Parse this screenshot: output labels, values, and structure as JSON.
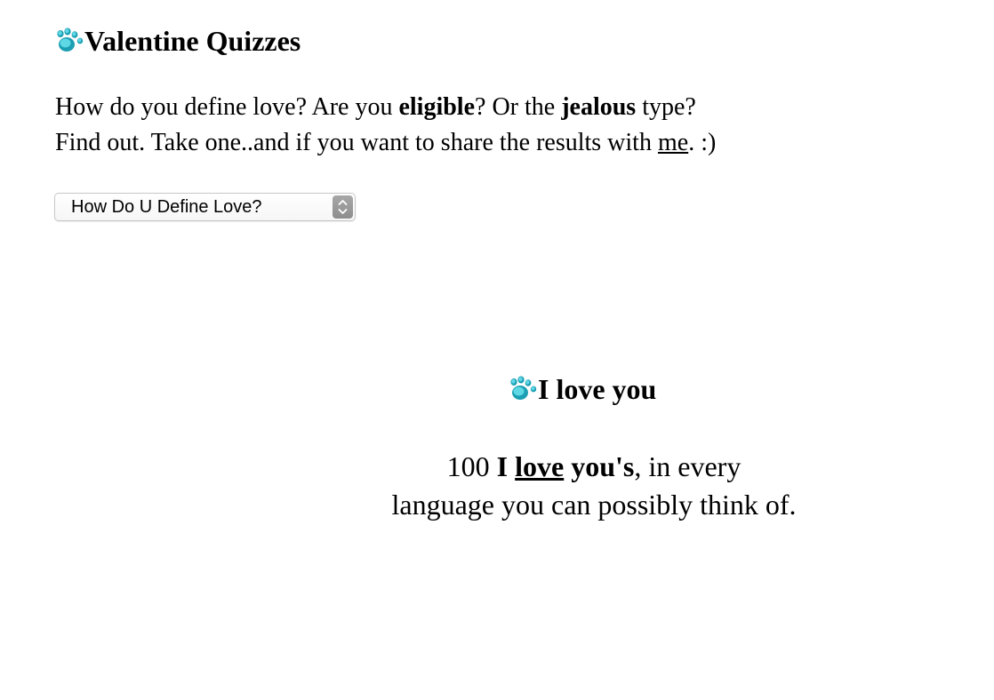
{
  "quiz_section": {
    "icon": "paw-print-icon",
    "title": "Valentine Quizzes",
    "intro": {
      "line1_part1": "How do you define love? Are you ",
      "line1_bold1": "eligible",
      "line1_part2": "? Or the ",
      "line1_bold2": "jealous",
      "line1_part3": " type?",
      "line2_part1": "Find out. Take one..and if you want to share the results with ",
      "line2_link": "me",
      "line2_part2": ". :)"
    },
    "quiz_select": {
      "selected": "How Do U Define Love?"
    }
  },
  "love_section": {
    "icon": "paw-print-icon",
    "title": "I love you",
    "text": {
      "part1": "100 ",
      "bold1": "I",
      "space1": " ",
      "link": "love",
      "space2": " ",
      "bold2": "you's",
      "part2": ", in every",
      "line2": "language you can possibly think of."
    }
  },
  "colors": {
    "paw_light": "#5fd8e6",
    "paw_dark": "#1c9fb3",
    "select_arrows": "#9a9a9a"
  }
}
